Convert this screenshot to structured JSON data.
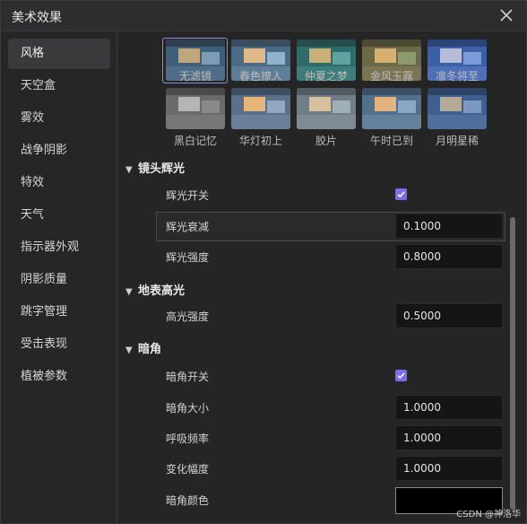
{
  "window": {
    "title": "美术效果",
    "close_icon": "close-icon"
  },
  "sidebar": {
    "items": [
      {
        "label": "风格",
        "active": true
      },
      {
        "label": "天空盒"
      },
      {
        "label": "雾效"
      },
      {
        "label": "战争阴影"
      },
      {
        "label": "特效"
      },
      {
        "label": "天气"
      },
      {
        "label": "指示器外观"
      },
      {
        "label": "阴影质量"
      },
      {
        "label": "跳字管理"
      },
      {
        "label": "受击表现"
      },
      {
        "label": "植被参数"
      }
    ]
  },
  "filters": {
    "row1": [
      "无滤镜",
      "春色撩人",
      "仲夏之梦",
      "金风玉露",
      "凛冬将至"
    ],
    "row2": [
      "黑白记忆",
      "华灯初上",
      "胶片",
      "午时已到",
      "月明星稀"
    ],
    "selected": "无滤镜"
  },
  "sections": {
    "lens_flare": {
      "title": "镜头辉光",
      "flare_toggle_label": "辉光开关",
      "flare_toggle_checked": true,
      "flare_decay_label": "辉光衰减",
      "flare_decay_value": "0.1000",
      "flare_intensity_label": "辉光强度",
      "flare_intensity_value": "0.8000"
    },
    "ground_highlight": {
      "title": "地表高光",
      "highlight_intensity_label": "高光强度",
      "highlight_intensity_value": "0.5000"
    },
    "vignette": {
      "title": "暗角",
      "toggle_label": "暗角开关",
      "toggle_checked": true,
      "size_label": "暗角大小",
      "size_value": "1.0000",
      "breath_label": "呼吸频率",
      "breath_value": "1.0000",
      "amplitude_label": "变化幅度",
      "amplitude_value": "1.0000",
      "color_label": "暗角颜色",
      "color_value": "#000000"
    }
  },
  "watermark": "CSDN @神洛华",
  "colors": {
    "accent": "#7b6cf0",
    "panel": "#252526",
    "input": "#151515"
  }
}
